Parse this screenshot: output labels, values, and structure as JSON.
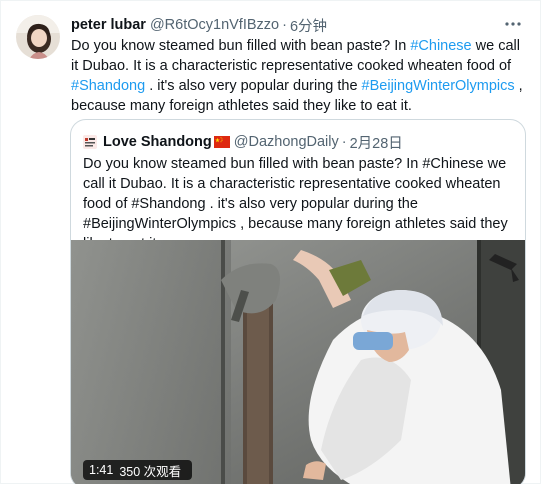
{
  "tweet": {
    "author_name": "peter lubar",
    "author_handle": "@R6tOcy1nVfIBzzo",
    "separator": "·",
    "time": "6分钟",
    "text_1": "Do you know steamed bun filled with bean paste? In ",
    "hashtag_chinese": "#Chinese",
    "text_2": "  we call it Dubao. It is a characteristic representative cooked wheaten food of ",
    "hashtag_shandong": "#Shandong",
    "text_3": " . it's also very popular during the ",
    "hashtag_olympics": "#BeijingWinterOlympics",
    "text_4": " , because many foreign athletes said they like to eat it.",
    "more_icon": "more-horizontal-icon",
    "link_color": "#1d9bf0"
  },
  "quoted": {
    "author_name": "Love Shandong",
    "flag_icon": "china-flag-icon",
    "author_handle": "@DazhongDaily",
    "separator": "·",
    "date": "2月28日",
    "text": "Do you know steamed bun filled with bean paste? In #Chinese  we call it Dubao. It is a characteristic representative cooked wheaten food of #Shandong . it's also very popular during the #BeijingWinterOlympics , because many foreign athletes said they like to eat it.",
    "video": {
      "duration": "1:41",
      "views": "350 次观看"
    }
  }
}
